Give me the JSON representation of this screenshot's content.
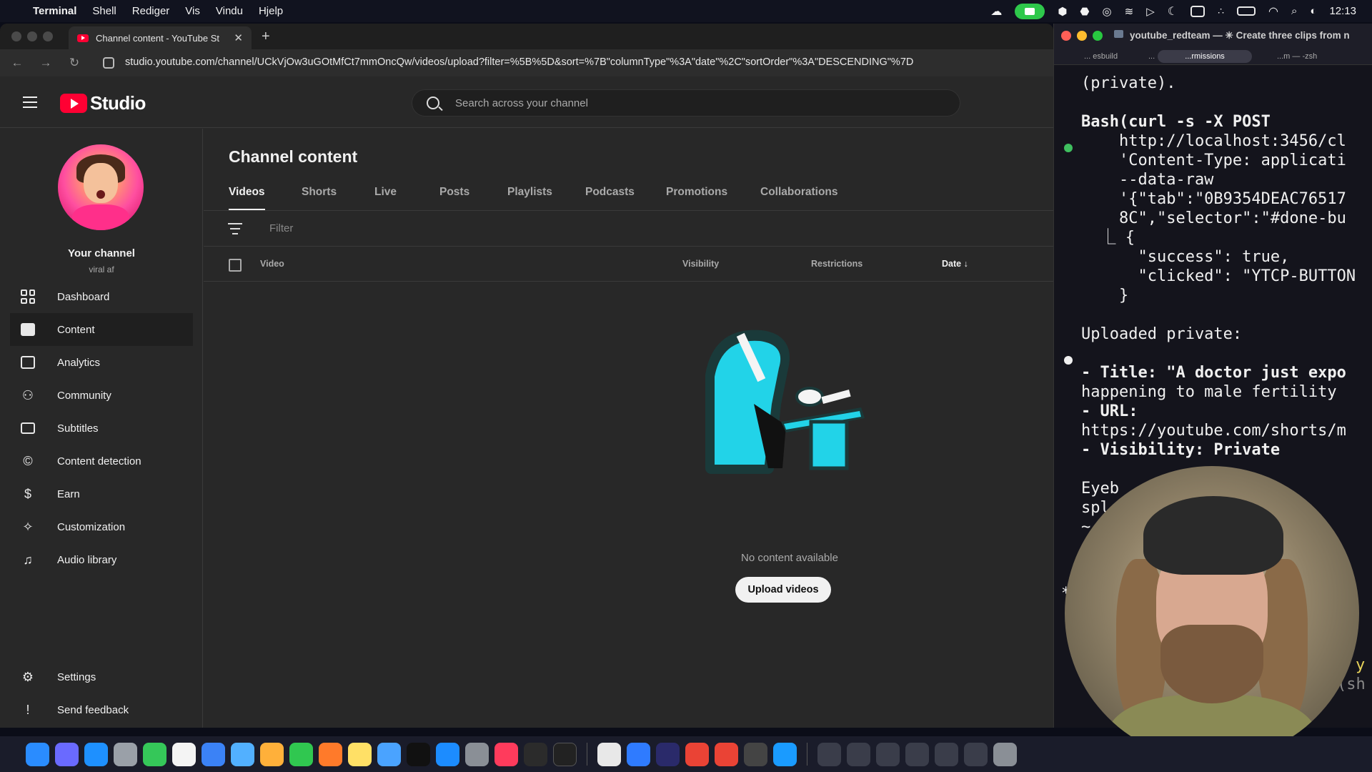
{
  "menubar": {
    "app": "Terminal",
    "items": [
      "Shell",
      "Rediger",
      "Vis",
      "Vindu",
      "Hjelp"
    ],
    "clock": "12:13"
  },
  "browser": {
    "tab_title": "Channel content - YouTube St",
    "url": "studio.youtube.com/channel/UCkVjOw3uGOtMfCt7mmOncQw/videos/upload?filter=%5B%5D&sort=%7B\"columnType\"%3A\"date\"%2C\"sortOrder\"%3A\"DESCENDING\"%7D"
  },
  "studio": {
    "logo_text": "Studio",
    "search_placeholder": "Search across your channel",
    "channel": {
      "name": "Your channel",
      "handle": "viral af"
    },
    "nav": [
      {
        "label": "Dashboard",
        "icon": "dashboard-icon"
      },
      {
        "label": "Content",
        "icon": "content-icon",
        "active": true
      },
      {
        "label": "Analytics",
        "icon": "analytics-icon"
      },
      {
        "label": "Community",
        "icon": "community-icon"
      },
      {
        "label": "Subtitles",
        "icon": "subtitles-icon"
      },
      {
        "label": "Content detection",
        "icon": "copyright-icon"
      },
      {
        "label": "Earn",
        "icon": "earn-icon"
      },
      {
        "label": "Customization",
        "icon": "customization-icon"
      },
      {
        "label": "Audio library",
        "icon": "audio-library-icon"
      }
    ],
    "nav_bottom": [
      {
        "label": "Settings",
        "icon": "settings-icon"
      },
      {
        "label": "Send feedback",
        "icon": "feedback-icon"
      }
    ],
    "page_title": "Channel content",
    "tabs": [
      "Videos",
      "Shorts",
      "Live",
      "Posts",
      "Playlists",
      "Podcasts",
      "Promotions",
      "Collaborations"
    ],
    "filter_placeholder": "Filter",
    "columns": {
      "video": "Video",
      "visibility": "Visibility",
      "restrictions": "Restrictions",
      "date": "Date"
    },
    "empty_text": "No content available",
    "upload_label": "Upload videos"
  },
  "terminal": {
    "title": "youtube_redteam — ✳ Create three clips from n",
    "tabs": [
      "... esbuild",
      "...",
      "...rmissions",
      "...m — -zsh"
    ],
    "lines": [
      "(private).",
      "",
      "Bash(curl -s -X POST",
      "    http://localhost:3456/cl",
      "    'Content-Type: applicati",
      "    --data-raw",
      "    '{\"tab\":\"0B9354DEAC76517",
      "    8C\",\"selector\":\"#done-bu",
      "  ⎿ {",
      "      \"success\": true,",
      "      \"clicked\": \"YTCP-BUTTON",
      "    }",
      "",
      "Uploaded private:",
      "",
      "- Title: \"A doctor just expo",
      "happening to male fertility",
      "- URL:",
      "https://youtube.com/shorts/m",
      "- Visibility: Private",
      "",
      "Eyeb",
      "spl",
      "~"
    ],
    "right_glyphs": [
      "y",
      "(sh"
    ],
    "colors": {
      "bullet_green": "#3fbf5f",
      "bullet_white": "#f0f0f0"
    }
  }
}
